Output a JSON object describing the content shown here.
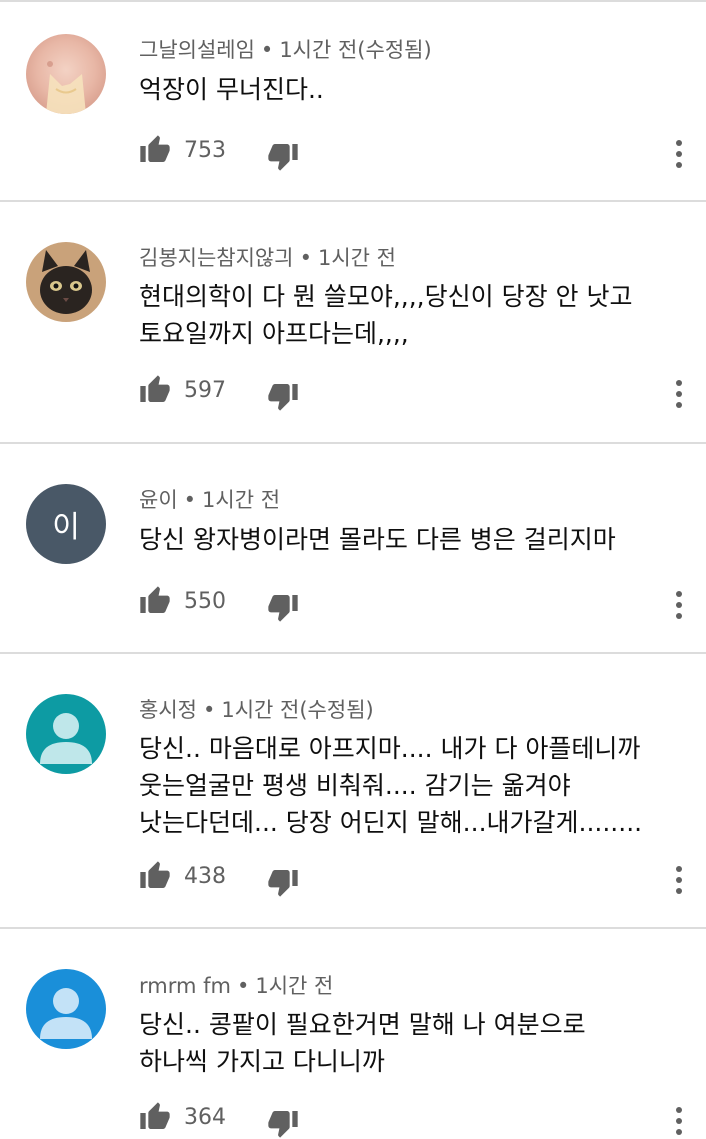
{
  "comments": [
    {
      "author": "그날의설레임",
      "time": "1시간 전(수정됨)",
      "lines": [
        "억장이 무너진다.."
      ],
      "likes": "753",
      "avatar_type": "photo-person"
    },
    {
      "author": "김봉지는참지않긔",
      "time": "1시간 전",
      "lines": [
        "현대의학이 다 뭔 쓸모야,,,,당신이 당장 안 낫고",
        "토요일까지 아프다는데,,,,"
      ],
      "likes": "597",
      "avatar_type": "photo-cat"
    },
    {
      "author": "윤이",
      "time": "1시간 전",
      "lines": [
        "당신 왕자병이라면 몰라도 다른 병은 걸리지마"
      ],
      "likes": "550",
      "avatar_letter": "이",
      "avatar_color": "#495867"
    },
    {
      "author": "홍시정",
      "time": "1시간 전(수정됨)",
      "lines": [
        "당신.. 마음대로 아프지마.... 내가 다 아플테니까",
        "웃는얼굴만 평생 비춰줘.... 감기는 옮겨야",
        "낫는다던데... 당장 어딘지 말해...내가갈게........"
      ],
      "likes": "438",
      "avatar_type": "default-person",
      "avatar_color": "#0d9ba3"
    },
    {
      "author": "rmrm fm",
      "time": "1시간 전",
      "lines": [
        "당신.. 콩팥이 필요한거면 말해 나 여분으로",
        "하나씩 가지고 다니니까"
      ],
      "likes": "364",
      "avatar_type": "default-person",
      "avatar_color": "#1a8fd9"
    }
  ],
  "separator": "•",
  "icons": {
    "like": "thumbs-up-icon",
    "dislike": "thumbs-down-icon",
    "more": "more-vertical-icon"
  }
}
